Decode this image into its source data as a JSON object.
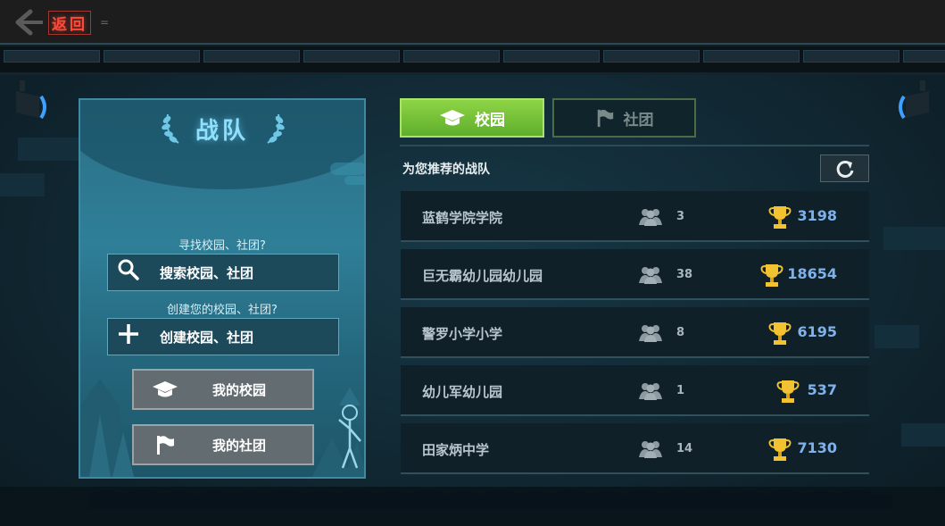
{
  "topbar": {
    "back_label": "返回",
    "back_mark": "="
  },
  "panel": {
    "title": "战队",
    "find_prompt": "寻找校园、社团?",
    "search_button": "搜索校园、社团",
    "create_prompt": "创建您的校园、社团?",
    "create_button": "创建校园、社团",
    "my_campus_button": "我的校园",
    "my_club_button": "我的社团"
  },
  "tabs": [
    {
      "label": "校园",
      "icon": "graduation-cap-icon",
      "active": true
    },
    {
      "label": "社团",
      "icon": "flag-icon",
      "active": false
    }
  ],
  "list": {
    "title": "为您推荐的战队",
    "refresh_icon": "refresh-icon",
    "teams": [
      {
        "name": "蓝鹤学院学院",
        "members": "3",
        "score": "3198"
      },
      {
        "name": "巨无霸幼儿园幼儿园",
        "members": "38",
        "score": "18654"
      },
      {
        "name": "警罗小学小学",
        "members": "8",
        "score": "6195"
      },
      {
        "name": "幼儿军幼儿园",
        "members": "1",
        "score": "537"
      },
      {
        "name": "田家炳中学",
        "members": "14",
        "score": "7130"
      }
    ]
  },
  "colors": {
    "accent_green": "#6fbf35",
    "title_cyan": "#8fe0ff",
    "score_blue": "#7fb2ea",
    "back_red": "#ff4a3a",
    "trophy_gold": "#f2c230"
  }
}
